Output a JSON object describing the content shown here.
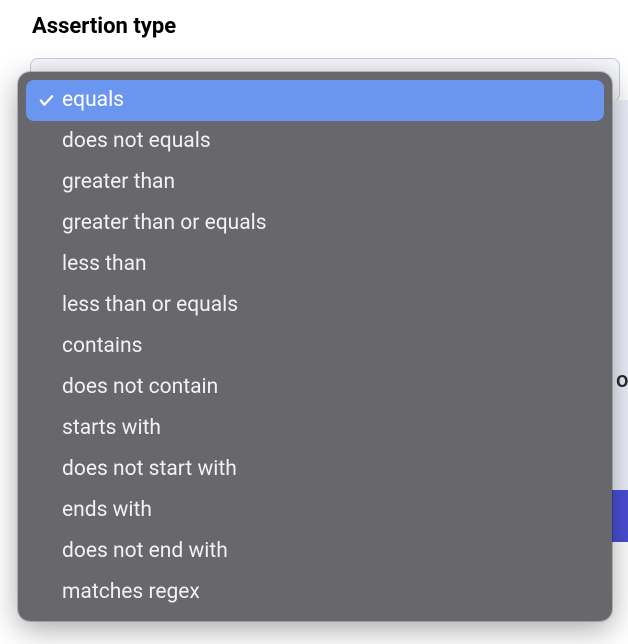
{
  "field": {
    "label": "Assertion type"
  },
  "dropdown": {
    "selected_index": 0,
    "options": [
      {
        "label": "equals"
      },
      {
        "label": "does not equals"
      },
      {
        "label": "greater than"
      },
      {
        "label": "greater than or equals"
      },
      {
        "label": "less than"
      },
      {
        "label": "less than or equals"
      },
      {
        "label": "contains"
      },
      {
        "label": "does not contain"
      },
      {
        "label": "starts with"
      },
      {
        "label": "does not start with"
      },
      {
        "label": "ends with"
      },
      {
        "label": "does not end with"
      },
      {
        "label": "matches regex"
      }
    ]
  },
  "background": {
    "partial_text": "o"
  }
}
